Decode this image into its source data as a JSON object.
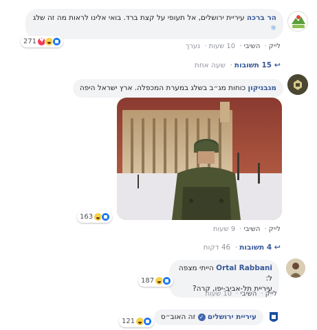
{
  "comments": [
    {
      "author": "הר ברכה",
      "text": "עיריית ירושלים, אל תעופי על קצת ברד. בואי אלינו לראות מה זה שלג",
      "emoji": "❄",
      "actions": {
        "like": "לייק",
        "reply": "השיבי",
        "time": "10 שעות",
        "edited": "נערך"
      },
      "reactions": {
        "count": "271",
        "types": [
          "like-icon",
          "haha-icon",
          "love-icon"
        ]
      },
      "replies": {
        "label": "15 תשובות",
        "time": "שעה אחת"
      }
    },
    {
      "author": "מגבניקון",
      "text": "כוחות מג״ב בשלג במערת המכפלה. ארץ ישראל היפה",
      "actions": {
        "like": "לייק",
        "reply": "השיבי",
        "time": "9 שעות"
      },
      "reactions": {
        "count": "163",
        "types": [
          "like-icon",
          "haha-icon"
        ]
      },
      "replies": {
        "label": "4 תשובות",
        "time": "46 דקות"
      }
    },
    {
      "author": "Ortal Rabbani",
      "text_line1": "הייתי מצפה ל:",
      "text_line2": "עיריית תל-אביב-יפו, קרה?",
      "actions": {
        "like": "לייק",
        "reply": "השיבי",
        "time": "10 שעות"
      },
      "reactions": {
        "count": "187",
        "types": [
          "like-icon",
          "haha-icon"
        ]
      }
    },
    {
      "author": "עיריית ירושלים",
      "text": "זה האוב״ס",
      "reactions": {
        "count": "121",
        "types": [
          "like-icon",
          "haha-icon"
        ]
      }
    }
  ],
  "colors": {
    "link": "#385898",
    "bubble": "#f2f3f5",
    "like": "#1877f2"
  }
}
